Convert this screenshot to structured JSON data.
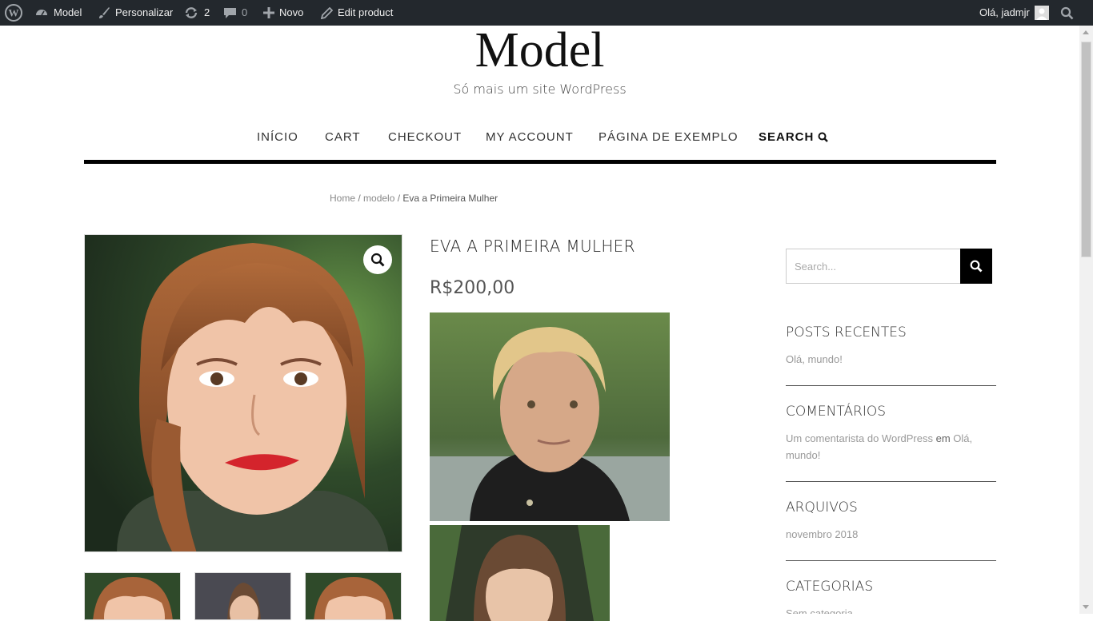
{
  "adminbar": {
    "site_name": "Model",
    "customize": "Personalizar",
    "updates_count": "2",
    "comments_count": "0",
    "new": "Novo",
    "edit": "Edit product",
    "greeting": "Olá, jadmjr"
  },
  "site": {
    "title": "Model",
    "description": "Só mais um site WordPress"
  },
  "nav": {
    "items": [
      "INÍCIO",
      "CART",
      "CHECKOUT",
      "MY ACCOUNT",
      "PÁGINA DE EXEMPLO"
    ],
    "search": "SEARCH"
  },
  "breadcrumb": {
    "home": "Home",
    "sep": " / ",
    "category": "modelo",
    "current": "Eva a Primeira Mulher"
  },
  "product": {
    "title": "EVA A PRIMEIRA MULHER",
    "price": "R$200,00"
  },
  "sidebar": {
    "search_placeholder": "Search...",
    "recent_posts_title": "POSTS RECENTES",
    "recent_post": "Olá, mundo!",
    "comments_title": "COMENTÁRIOS",
    "comment_author": "Um comentarista do WordPress",
    "comment_on": " em ",
    "comment_post": "Olá, mundo!",
    "archives_title": "ARQUIVOS",
    "archive": "novembro 2018",
    "categories_title": "CATEGORIAS",
    "category": "Sem categoria"
  },
  "colors": {
    "admin_bar": "#23282d",
    "accent": "#000000"
  }
}
